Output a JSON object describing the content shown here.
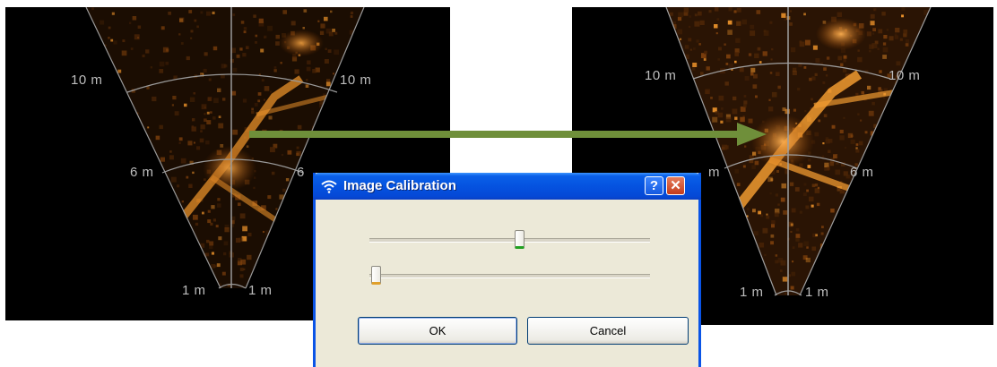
{
  "sonar_left": {
    "labels": {
      "far_left": "10 m",
      "far_right": "10 m",
      "mid_left": "6 m",
      "mid_right": "6",
      "near_left": "1 m",
      "near_right": "1 m"
    }
  },
  "sonar_right": {
    "labels": {
      "far_left": "10 m",
      "far_right": "10 m",
      "mid_left": "m",
      "mid_right": "6 m",
      "near_left": "1 m",
      "near_right": "1 m"
    }
  },
  "arrow": {
    "color": "#6f8f3a",
    "icon": "arrow-right-icon"
  },
  "dialog": {
    "title": "Image Calibration",
    "title_icon": "wireless-icon",
    "help_label": "?",
    "close_label": "✕",
    "sliders": [
      {
        "name": "slider-1",
        "value": 0.53,
        "accent": "#21a121"
      },
      {
        "name": "slider-2",
        "value": 0.0,
        "accent": "#e0a02a"
      }
    ],
    "ok_label": "OK",
    "cancel_label": "Cancel"
  },
  "colors": {
    "sonar_glow": "#e8902a",
    "titlebar": "#0553e0",
    "dialog_bg": "#ece9d8"
  }
}
